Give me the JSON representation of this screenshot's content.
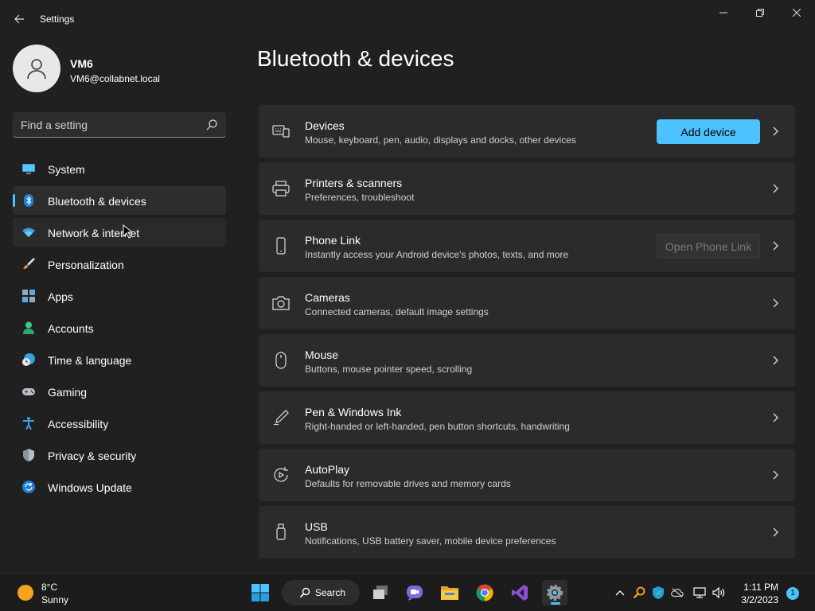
{
  "window": {
    "title": "Settings",
    "back_icon": "arrow-left-icon",
    "minimize_icon": "minimize-icon",
    "maximize_icon": "restore-icon",
    "close_icon": "close-icon"
  },
  "profile": {
    "name": "VM6",
    "email": "VM6@collabnet.local"
  },
  "search": {
    "placeholder": "Find a setting"
  },
  "sidebar": {
    "items": [
      {
        "label": "System",
        "icon": "monitor-icon"
      },
      {
        "label": "Bluetooth & devices",
        "icon": "bluetooth-icon",
        "selected": true
      },
      {
        "label": "Network & internet",
        "icon": "wifi-icon",
        "hovered": true
      },
      {
        "label": "Personalization",
        "icon": "brush-icon"
      },
      {
        "label": "Apps",
        "icon": "apps-icon"
      },
      {
        "label": "Accounts",
        "icon": "person-icon"
      },
      {
        "label": "Time & language",
        "icon": "clock-globe-icon"
      },
      {
        "label": "Gaming",
        "icon": "gamepad-icon"
      },
      {
        "label": "Accessibility",
        "icon": "accessibility-icon"
      },
      {
        "label": "Privacy & security",
        "icon": "shield-icon"
      },
      {
        "label": "Windows Update",
        "icon": "update-icon"
      }
    ]
  },
  "main": {
    "title": "Bluetooth & devices",
    "cards": [
      {
        "title": "Devices",
        "subtitle": "Mouse, keyboard, pen, audio, displays and docks, other devices",
        "icon": "devices-icon",
        "button": "Add device"
      },
      {
        "title": "Printers & scanners",
        "subtitle": "Preferences, troubleshoot",
        "icon": "printer-icon"
      },
      {
        "title": "Phone Link",
        "subtitle": "Instantly access your Android device's photos, texts, and more",
        "icon": "phone-icon",
        "button": "Open Phone Link"
      },
      {
        "title": "Cameras",
        "subtitle": "Connected cameras, default image settings",
        "icon": "camera-icon"
      },
      {
        "title": "Mouse",
        "subtitle": "Buttons, mouse pointer speed, scrolling",
        "icon": "mouse-icon"
      },
      {
        "title": "Pen & Windows Ink",
        "subtitle": "Right-handed or left-handed, pen button shortcuts, handwriting",
        "icon": "pen-icon"
      },
      {
        "title": "AutoPlay",
        "subtitle": "Defaults for removable drives and memory cards",
        "icon": "autoplay-icon"
      },
      {
        "title": "USB",
        "subtitle": "Notifications, USB battery saver, mobile device preferences",
        "icon": "usb-icon"
      }
    ]
  },
  "taskbar": {
    "weather": {
      "temp": "8°C",
      "condition": "Sunny"
    },
    "search_label": "Search",
    "time": "1:11 PM",
    "date": "3/2/2023",
    "notification_count": "1"
  },
  "colors": {
    "accent": "#4cc2ff",
    "background": "#202020",
    "card": "#2b2b2b"
  }
}
